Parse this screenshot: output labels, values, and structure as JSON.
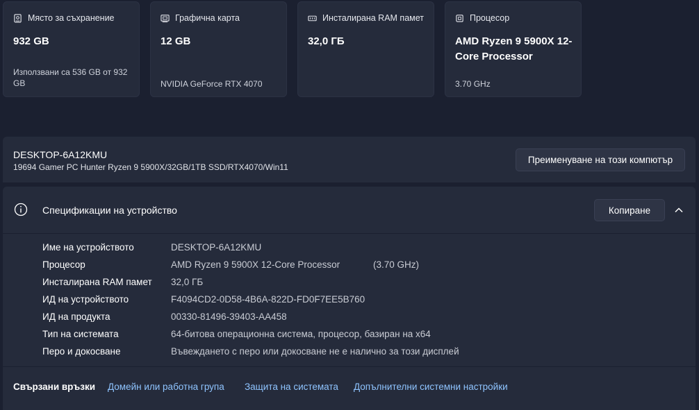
{
  "cards": [
    {
      "label": "Място за съхранение",
      "value": "932 GB",
      "sub": "Използвани са 536 GB от 932 GB",
      "icon": "storage-icon"
    },
    {
      "label": "Графична карта",
      "value": "12 GB",
      "sub": "NVIDIA GeForce RTX 4070",
      "icon": "gpu-icon"
    },
    {
      "label": "Инсталирана RAM памет",
      "value": "32,0 ГБ",
      "sub": "",
      "icon": "ram-icon"
    },
    {
      "label": "Процесор",
      "value": "AMD Ryzen 9 5900X 12-Core Processor",
      "sub": "3.70 GHz",
      "icon": "cpu-icon"
    }
  ],
  "pc": {
    "name": "DESKTOP-6A12KMU",
    "model": "19694 Gamer PC Hunter Ryzen 9 5900X/32GB/1TB SSD/RTX4070/Win11",
    "rename_label": "Преименуване на този компютър"
  },
  "specs": {
    "title": "Спецификации на устройство",
    "copy_label": "Копиране",
    "rows": [
      {
        "key": "Име на устройството",
        "value": "DESKTOP-6A12KMU",
        "extra": ""
      },
      {
        "key": "Процесор",
        "value": "AMD Ryzen 9 5900X 12-Core Processor",
        "extra": "(3.70 GHz)"
      },
      {
        "key": "Инсталирана RAM памет",
        "value": "32,0 ГБ",
        "extra": ""
      },
      {
        "key": "ИД на устройството",
        "value": "F4094CD2-0D58-4B6A-822D-FD0F7EE5B760",
        "extra": ""
      },
      {
        "key": "ИД на продукта",
        "value": "00330-81496-39403-AA458",
        "extra": ""
      },
      {
        "key": "Тип на системата",
        "value": "64-битова операционна система, процесор, базиран на x64",
        "extra": ""
      },
      {
        "key": "Перо и докосване",
        "value": "Въвеждането с перо или докосване не е налично за този дисплей",
        "extra": ""
      }
    ]
  },
  "related": {
    "title": "Свързани връзки",
    "links": [
      "Домейн или работна група",
      "Защита на системата",
      "Допълнителни системни настройки"
    ]
  },
  "colors": {
    "background": "#1b2030",
    "card": "#252b3b",
    "link": "#8fc4ff"
  }
}
